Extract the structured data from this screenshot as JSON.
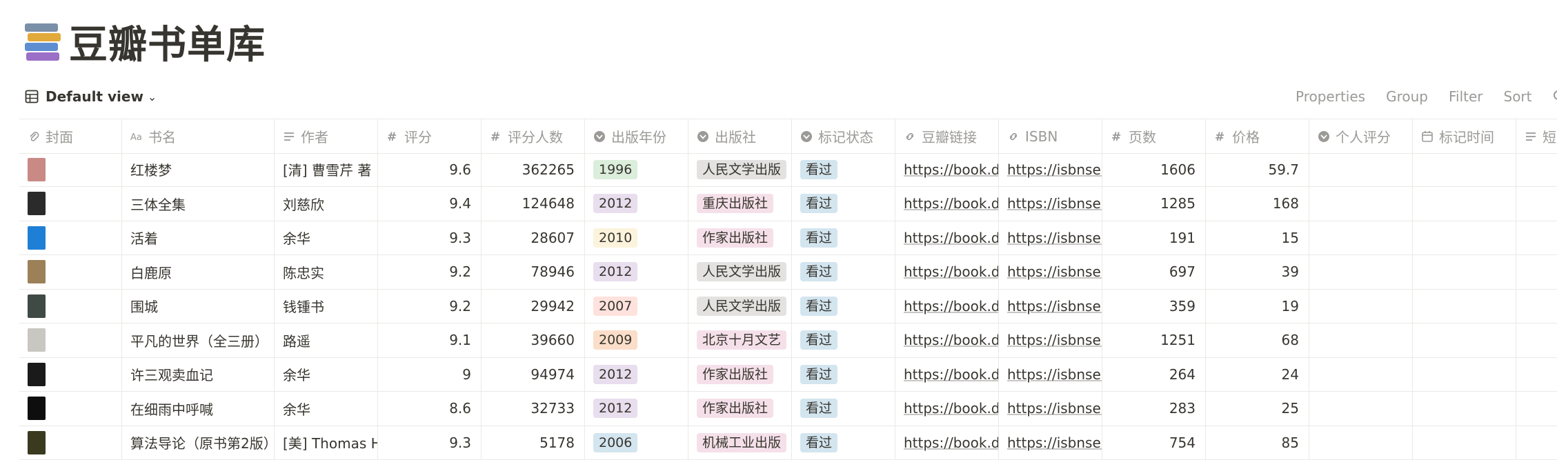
{
  "page": {
    "title": "豆瓣书单库",
    "icon": "books-icon"
  },
  "view": {
    "label": "Default view",
    "icon": "table-icon"
  },
  "actions": {
    "properties": "Properties",
    "group": "Group",
    "filter": "Filter",
    "sort": "Sort",
    "search": "Se"
  },
  "columns": [
    {
      "label": "封面",
      "icon": "attachment-icon"
    },
    {
      "label": "书名",
      "icon": "title-icon"
    },
    {
      "label": "作者",
      "icon": "text-icon"
    },
    {
      "label": "评分",
      "icon": "number-icon"
    },
    {
      "label": "评分人数",
      "icon": "number-icon"
    },
    {
      "label": "出版年份",
      "icon": "select-icon"
    },
    {
      "label": "出版社",
      "icon": "select-icon"
    },
    {
      "label": "标记状态",
      "icon": "select-icon"
    },
    {
      "label": "豆瓣链接",
      "icon": "url-icon"
    },
    {
      "label": "ISBN",
      "icon": "url-icon"
    },
    {
      "label": "页数",
      "icon": "number-icon"
    },
    {
      "label": "价格",
      "icon": "number-icon"
    },
    {
      "label": "个人评分",
      "icon": "select-icon"
    },
    {
      "label": "标记时间",
      "icon": "date-icon"
    },
    {
      "label": "短",
      "icon": "text-icon"
    }
  ],
  "tag_colors": {
    "green": "#dbeddb",
    "purple": "#e8deee",
    "yellow": "#fbf3db",
    "red": "#ffe2dd",
    "orange": "#fadec9",
    "pink": "#f5e0e9",
    "gray": "#e3e2e0",
    "blue": "#d3e5ef"
  },
  "rows": [
    {
      "cover_color": "#c98a86",
      "title": "红楼梦",
      "author": "[清] 曹雪芹 著",
      "rating": "9.6",
      "votes": "362265",
      "year": "1996",
      "year_color": "green",
      "publisher": "人民文学出版",
      "publisher_color": "gray",
      "status": "看过",
      "status_color": "blue",
      "douban": "https://book.do",
      "isbn": "https://isbnsea",
      "pages": "1606",
      "price": "59.7"
    },
    {
      "cover_color": "#2b2b2b",
      "title": "三体全集",
      "author": "刘慈欣",
      "rating": "9.4",
      "votes": "124648",
      "year": "2012",
      "year_color": "purple",
      "publisher": "重庆出版社",
      "publisher_color": "pink",
      "status": "看过",
      "status_color": "blue",
      "douban": "https://book.do",
      "isbn": "https://isbnsea",
      "pages": "1285",
      "price": "168"
    },
    {
      "cover_color": "#1e7fd6",
      "title": "活着",
      "author": "余华",
      "rating": "9.3",
      "votes": "28607",
      "year": "2010",
      "year_color": "yellow",
      "publisher": "作家出版社",
      "publisher_color": "pink",
      "status": "看过",
      "status_color": "blue",
      "douban": "https://book.do",
      "isbn": "https://isbnsea",
      "pages": "191",
      "price": "15"
    },
    {
      "cover_color": "#9c8158",
      "title": "白鹿原",
      "author": "陈忠实",
      "rating": "9.2",
      "votes": "78946",
      "year": "2012",
      "year_color": "purple",
      "publisher": "人民文学出版",
      "publisher_color": "gray",
      "status": "看过",
      "status_color": "blue",
      "douban": "https://book.do",
      "isbn": "https://isbnsea",
      "pages": "697",
      "price": "39"
    },
    {
      "cover_color": "#3f4a44",
      "title": "围城",
      "author": "钱锺书",
      "rating": "9.2",
      "votes": "29942",
      "year": "2007",
      "year_color": "red",
      "publisher": "人民文学出版",
      "publisher_color": "gray",
      "status": "看过",
      "status_color": "blue",
      "douban": "https://book.do",
      "isbn": "https://isbnsea",
      "pages": "359",
      "price": "19"
    },
    {
      "cover_color": "#c9c7c2",
      "title": "平凡的世界（全三册）",
      "author": "路遥",
      "rating": "9.1",
      "votes": "39660",
      "year": "2009",
      "year_color": "orange",
      "publisher": "北京十月文艺",
      "publisher_color": "pink",
      "status": "看过",
      "status_color": "blue",
      "douban": "https://book.do",
      "isbn": "https://isbnsea",
      "pages": "1251",
      "price": "68"
    },
    {
      "cover_color": "#1a1a1a",
      "title": "许三观卖血记",
      "author": "余华",
      "rating": "9",
      "votes": "94974",
      "year": "2012",
      "year_color": "purple",
      "publisher": "作家出版社",
      "publisher_color": "pink",
      "status": "看过",
      "status_color": "blue",
      "douban": "https://book.do",
      "isbn": "https://isbnsea",
      "pages": "264",
      "price": "24"
    },
    {
      "cover_color": "#0e0e0e",
      "title": "在细雨中呼喊",
      "author": "余华",
      "rating": "8.6",
      "votes": "32733",
      "year": "2012",
      "year_color": "purple",
      "publisher": "作家出版社",
      "publisher_color": "pink",
      "status": "看过",
      "status_color": "blue",
      "douban": "https://book.do",
      "isbn": "https://isbnsea",
      "pages": "283",
      "price": "25"
    },
    {
      "cover_color": "#3a3a1f",
      "title": "算法导论（原书第2版）",
      "author": "[美] Thomas H",
      "rating": "9.3",
      "votes": "5178",
      "year": "2006",
      "year_color": "blue",
      "publisher": "机械工业出版",
      "publisher_color": "pink",
      "status": "看过",
      "status_color": "blue",
      "douban": "https://book.do",
      "isbn": "https://isbnsea",
      "pages": "754",
      "price": "85"
    }
  ]
}
